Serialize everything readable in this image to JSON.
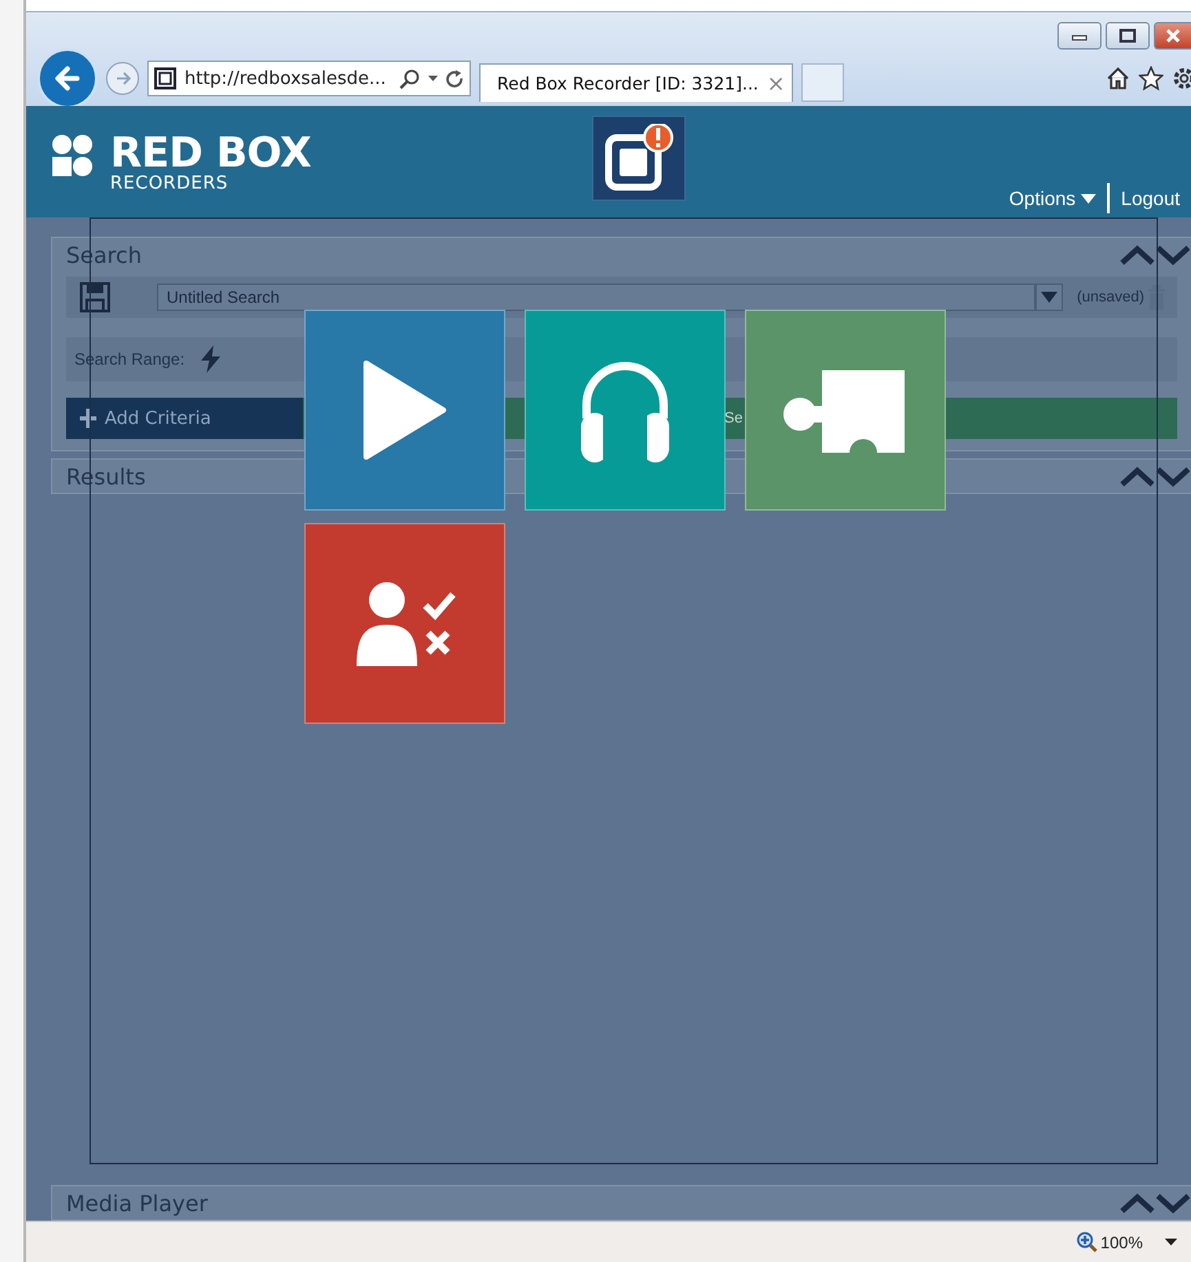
{
  "browser": {
    "address": "http://redboxsalesde...",
    "tab": {
      "title": "Red Box Recorder [ID: 3321]...",
      "close": "×"
    },
    "zoom": "100%"
  },
  "header": {
    "brand": "RED BOX",
    "brand_sub": "RECORDERS",
    "menu": [
      "Options",
      "Logout"
    ]
  },
  "search": {
    "title": "Search",
    "name": "Untitled Search",
    "save_state": "(unsaved)",
    "range_label": "Search Range:",
    "add_button": "Add Criteria",
    "search_button": "Se"
  },
  "panels": [
    {
      "title": "Results"
    },
    {
      "title": "Media Player"
    }
  ],
  "tiles": [
    {
      "kind": "play",
      "color": "#2878a8"
    },
    {
      "kind": "headphones",
      "color": "#079b97"
    },
    {
      "kind": "puzzle",
      "color": "#5a9468"
    },
    {
      "kind": "person-check",
      "color": "#c33b2e"
    }
  ]
}
